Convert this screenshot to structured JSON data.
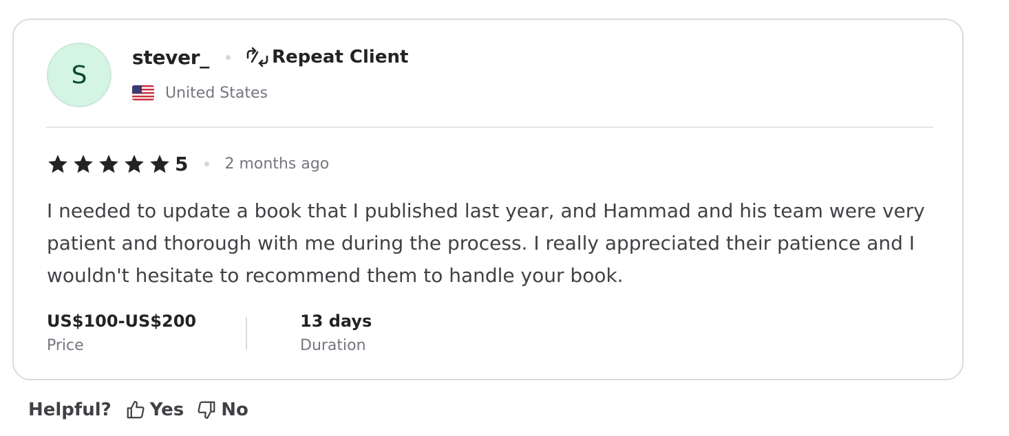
{
  "reviewer": {
    "initial": "S",
    "username": "stever_",
    "badge_label": "Repeat Client",
    "badge_icon": "repeat-icon",
    "country": "United States",
    "flag_icon": "us-flag-icon",
    "avatar_color": "#d4f5e4"
  },
  "rating": {
    "stars": 5,
    "value": "5",
    "time_ago": "2 months ago"
  },
  "review_text": "I needed to update a book that I published last year, and Hammad and his team were very patient and thorough with me during the process. I really appreciated their patience and I wouldn't hesitate to recommend them to handle your book.",
  "meta": {
    "price_value": "US$100-US$200",
    "price_label": "Price",
    "duration_value": "13 days",
    "duration_label": "Duration"
  },
  "helpful": {
    "question": "Helpful?",
    "yes_label": "Yes",
    "no_label": "No"
  }
}
